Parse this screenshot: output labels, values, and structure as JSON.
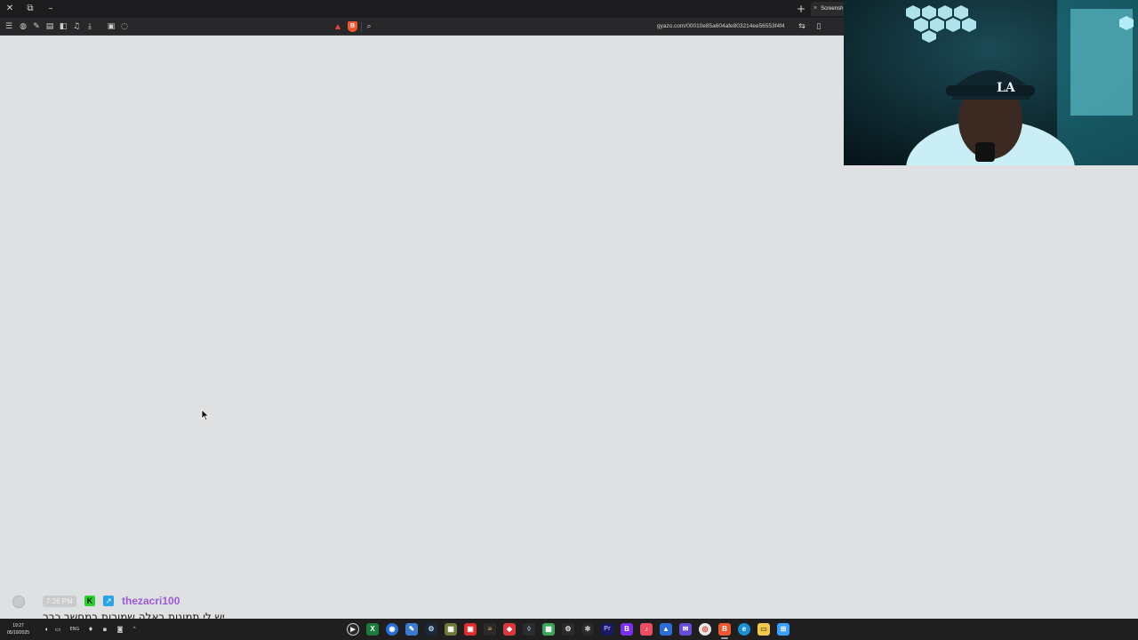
{
  "browser": {
    "tab_title": "Screensh",
    "url": "gyazo.com/00010e85a604afe803214ee56553f4f4",
    "window_controls": [
      "close-icon",
      "restore-icon",
      "minimize-icon"
    ],
    "toolbar_icons": [
      "menu-icon",
      "shield-icon",
      "pin-icon",
      "reader-icon",
      "sidebar-icon",
      "music-icon",
      "download-icon",
      "tabs-icon",
      "chat-icon"
    ],
    "new_tab_label": "+",
    "close_tab_label": "×"
  },
  "chat": {
    "time": "7:26 PM",
    "username": "thezacri100",
    "username_color": "#9b59d8",
    "message_overlay": "יש לי תמונות באלה שמורות במחשב כבר"
  },
  "taskbar": {
    "time": "19:27",
    "date": "05/10/2025",
    "language": "ENG",
    "apps": [
      "media-player",
      "excel",
      "tool",
      "editor",
      "steam",
      "game",
      "video",
      "notes",
      "redapp",
      "tool2",
      "teams",
      "gear",
      "chatgpt",
      "premiere",
      "purple",
      "music",
      "mail",
      "chrome",
      "brave",
      "edge",
      "explorer",
      "start"
    ]
  },
  "colors": {
    "page_bg": "#dee0e2",
    "titlebar_bg": "#1c1c1e",
    "toolbar_bg": "#28282b",
    "taskbar_bg": "#1f1f1f"
  }
}
